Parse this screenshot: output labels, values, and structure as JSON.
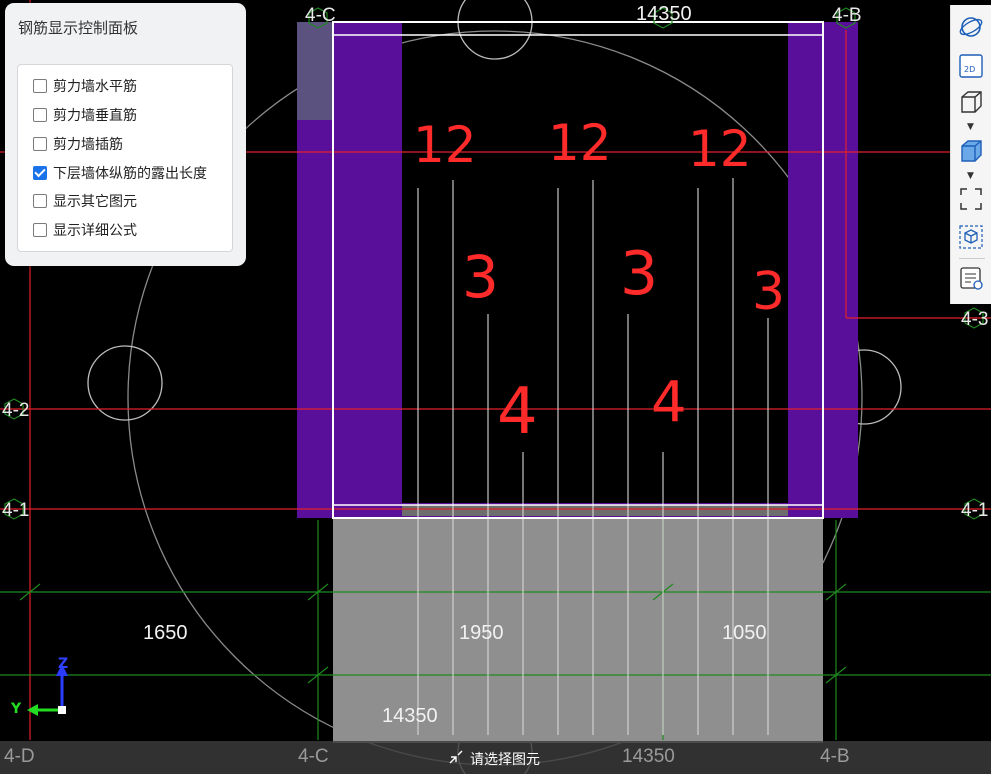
{
  "panel": {
    "title": "钢筋显示控制面板",
    "options": [
      {
        "label": "剪力墙水平筋",
        "checked": false
      },
      {
        "label": "剪力墙垂直筋",
        "checked": false
      },
      {
        "label": "剪力墙插筋",
        "checked": false
      },
      {
        "label": "下层墙体纵筋的露出长度",
        "checked": true
      },
      {
        "label": "显示其它图元",
        "checked": false
      },
      {
        "label": "显示详细公式",
        "checked": false
      }
    ]
  },
  "grid_labels": {
    "top_c": "4-C",
    "top_b": "4-B",
    "left_2": "4-2",
    "left_1": "4-1",
    "right_3": "4-3",
    "right_1": "4-1",
    "bottom_d": "4-D",
    "bottom_c": "4-C",
    "bottom_b": "4-B"
  },
  "dimensions": {
    "top": "14350",
    "bottom_left": "1650",
    "bottom_mid": "1950",
    "bottom_right": "1050",
    "bottom_total": "14350",
    "status_dim": "14350"
  },
  "annotations": {
    "n12a": "12",
    "n12b": "12",
    "n12c": "12",
    "n3a": "3",
    "n3b": "3",
    "n3c": "3",
    "n4a": "4",
    "n4b": "4"
  },
  "axes": {
    "z": "Z",
    "y": "Y"
  },
  "status": {
    "message": "请选择图元"
  },
  "toolbar": {
    "icons": [
      "orbit-icon",
      "view-2d-icon",
      "view-3d-wire-icon",
      "view-3d-solid-icon",
      "fit-frame-icon",
      "component-icon",
      "rebar-list-icon"
    ],
    "label_2d": "2D"
  },
  "colors": {
    "background": "#000000",
    "axis_red": "#e0202a",
    "axis_green": "#1f8a1f",
    "wall_purple": "#5a0f9a",
    "annotation_red": "#ff2a2a",
    "check_blue": "#1a73e8"
  }
}
